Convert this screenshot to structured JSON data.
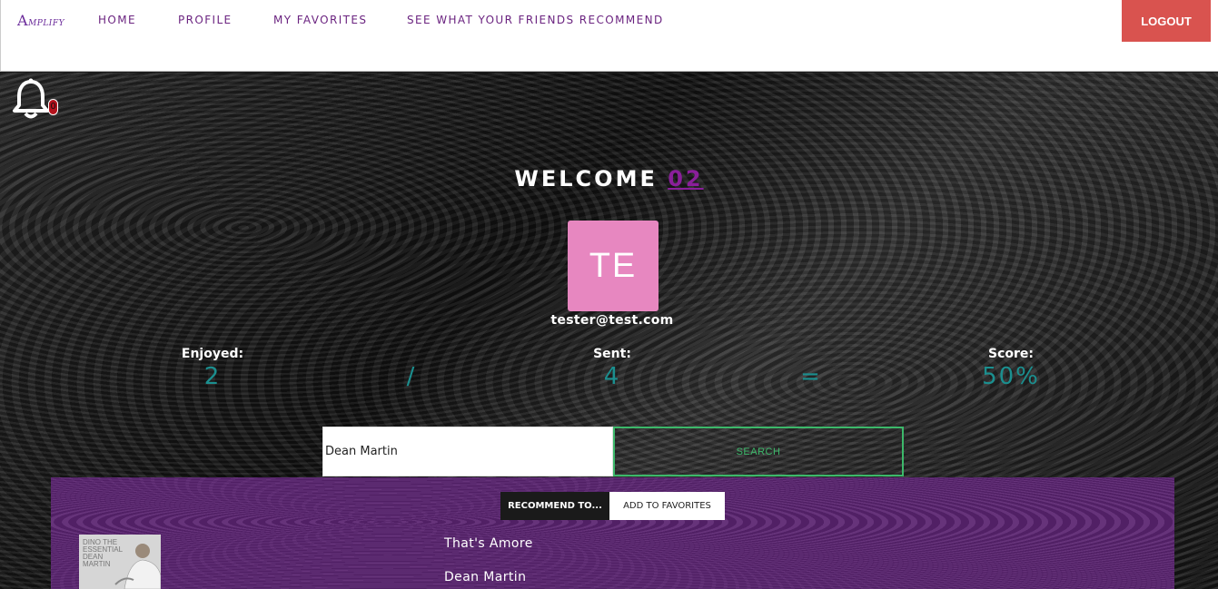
{
  "nav": {
    "logo_first": "A",
    "logo_rest": "MPLIFY",
    "links": [
      "HOME",
      "PROFILE",
      "MY FAVORITES",
      "SEE WHAT YOUR FRIENDS RECOMMEND"
    ],
    "logout_label": "LOGOUT"
  },
  "notifications": {
    "count": "0",
    "icon": "bell-icon"
  },
  "welcome": {
    "prefix": "WELCOME",
    "username": "02"
  },
  "profile": {
    "initials": "TE",
    "email": "tester@test.com"
  },
  "stats": {
    "enjoyed_label": "Enjoyed:",
    "enjoyed_value": "2",
    "divide_symbol": "/",
    "sent_label": "Sent:",
    "sent_value": "4",
    "equals_symbol": "=",
    "score_label": "Score:",
    "score_value": "50%"
  },
  "search": {
    "value": "Dean Martin",
    "button_label": "SEARCH"
  },
  "actions": {
    "recommend_label": "RECOMMEND TO...",
    "favorite_label": "ADD TO FAVORITES"
  },
  "result": {
    "album_text": "DINO THE ESSENTIAL DEAN MARTIN",
    "title": "That's Amore",
    "artist": "Dean Martin"
  },
  "colors": {
    "accent": "#6b2480",
    "logout": "#d9534f",
    "stat": "#1b8f8f",
    "search": "#3cb86a",
    "avatar": "#e787c0",
    "results_bg": "#5a2470"
  }
}
